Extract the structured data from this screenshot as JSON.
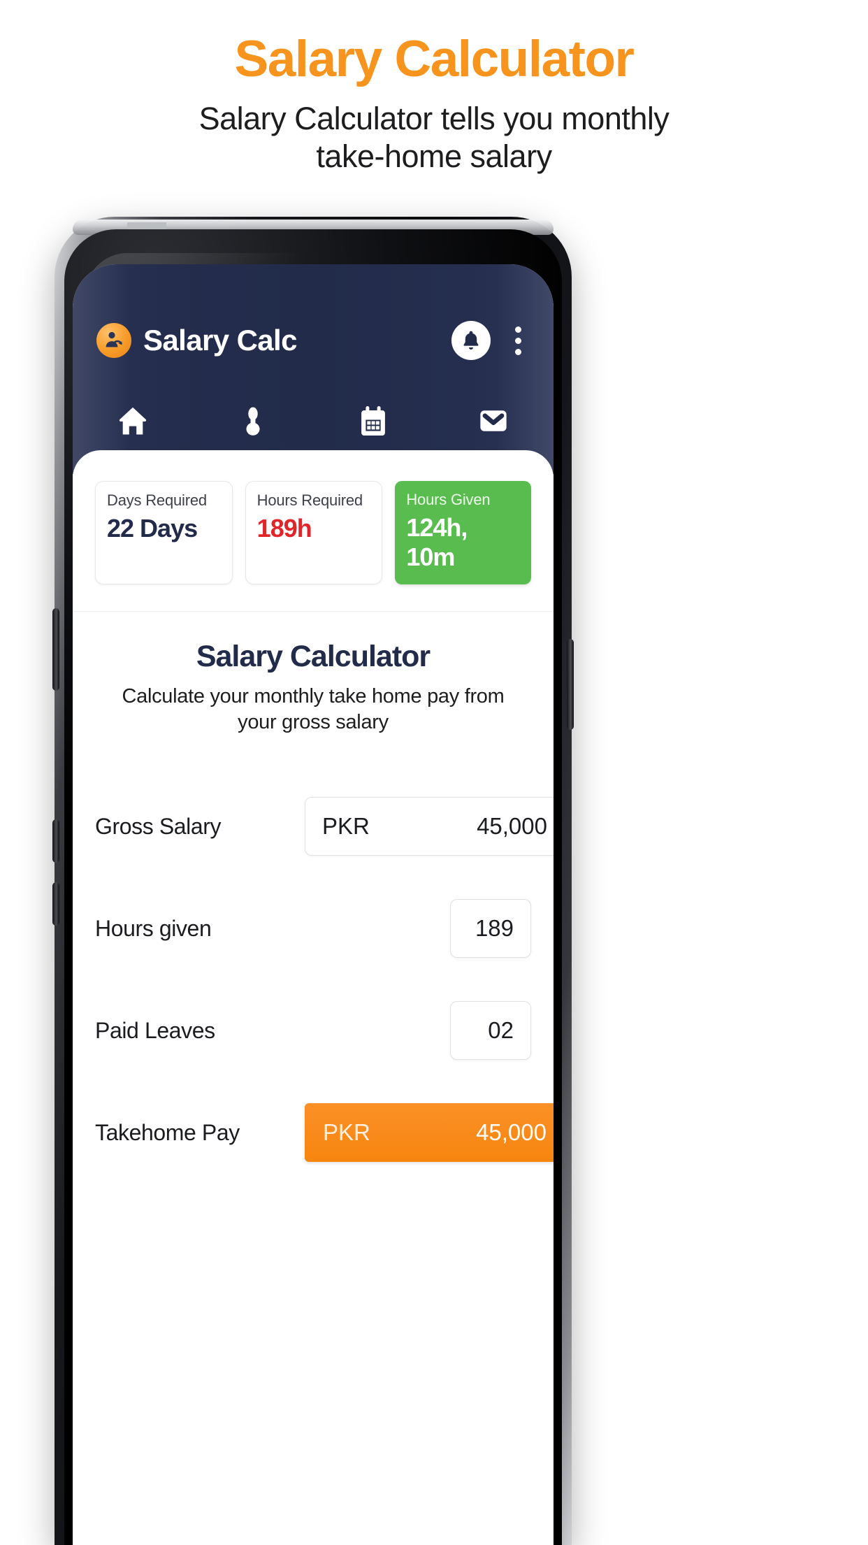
{
  "promo": {
    "title": "Salary Calculator",
    "subtitle": "Salary Calculator tells you monthly take-home salary"
  },
  "colors": {
    "brand_orange": "#F7941E",
    "appbar_navy": "#222B4A",
    "danger_red": "#E0252B",
    "success_green": "#59BC4E",
    "accent_orange": "#FB9027"
  },
  "app": {
    "appbar": {
      "brand_name": "Salary Calc",
      "logo_icon": "person-check-circle-icon",
      "notifications_icon": "bell-icon",
      "overflow_icon": "more-vertical-icon"
    },
    "tabs": [
      {
        "name": "home",
        "icon": "home-icon"
      },
      {
        "name": "profile",
        "icon": "person-icon"
      },
      {
        "name": "calendar",
        "icon": "calendar-icon"
      },
      {
        "name": "messages",
        "icon": "envelope-icon"
      }
    ],
    "stats": [
      {
        "label": "Days Required",
        "value": "22 Days"
      },
      {
        "label": "Hours Required",
        "value": "189h"
      },
      {
        "label": "Hours Given",
        "value": "124h, 10m"
      }
    ],
    "calculator": {
      "title": "Salary Calculator",
      "description": "Calculate your monthly take home pay from your gross salary",
      "rows": [
        {
          "label": "Gross Salary",
          "currency": "PKR",
          "value": "45,000"
        },
        {
          "label": "Hours given",
          "currency": "",
          "value": "189"
        },
        {
          "label": "Paid Leaves",
          "currency": "",
          "value": "02"
        },
        {
          "label": "Takehome Pay",
          "currency": "PKR",
          "value": "45,000"
        }
      ]
    }
  }
}
